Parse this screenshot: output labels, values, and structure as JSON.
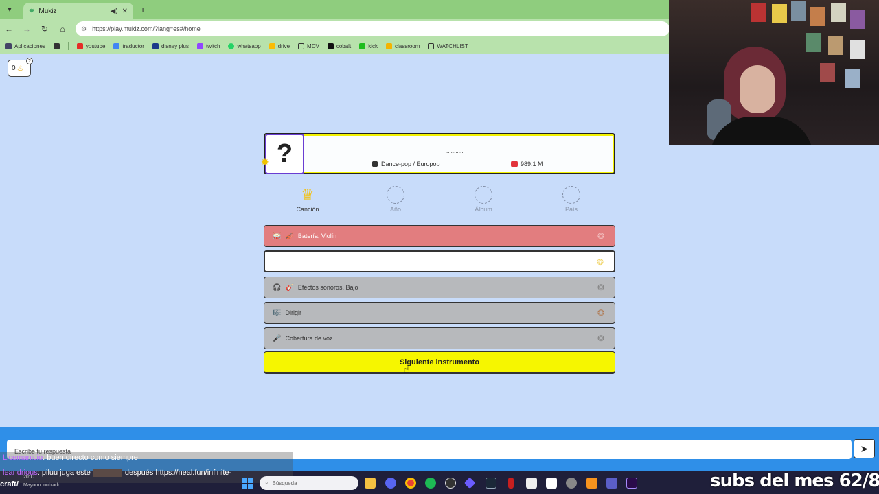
{
  "browser": {
    "tab_title": "Mukiz",
    "url": "https://play.mukiz.com/?lang=es#/home",
    "bookmarks": [
      "Aplicaciones",
      "youtube",
      "traductor",
      "disney plus",
      "twitch",
      "whatsapp",
      "drive",
      "MDV",
      "cobalt",
      "kick",
      "classroom",
      "WATCHLIST"
    ]
  },
  "game": {
    "streak": "0",
    "mystery": "?",
    "genre": "Dance-pop / Europop",
    "plays": "989.1 M",
    "steps": [
      {
        "label": "Canción",
        "active": true
      },
      {
        "label": "Año",
        "active": false
      },
      {
        "label": "Álbum",
        "active": false
      },
      {
        "label": "País",
        "active": false
      }
    ],
    "rows": [
      {
        "text": "Batería, Violín",
        "state": "wrong"
      },
      {
        "text": "",
        "state": "current"
      },
      {
        "text": "Efectos sonoros, Bajo",
        "state": "locked"
      },
      {
        "text": "Dirigir",
        "state": "locked"
      },
      {
        "text": "Cobertura de voz",
        "state": "locked"
      }
    ],
    "next_button": "Siguiente instrumento",
    "answer_placeholder": "Escribe tu respuesta",
    "send_icon": "send-arrow-icon"
  },
  "chat": {
    "line1_user": "Licemanicio",
    "line1_text": ": buen directo como siempre",
    "line2_user": "leandrious",
    "line2_text": ": piluu juga este",
    "line2_text_after": "después https://neal.fun/infinite-",
    "line3_text": "craft/"
  },
  "taskbar": {
    "weather_temp": "20°C",
    "weather_desc": "Mayorm. nublado",
    "search_placeholder": "Búsqueda"
  },
  "overlay": {
    "subs_text": "subs del mes 62/80"
  },
  "colors": {
    "page_bg": "#c8dcfa",
    "accent_yellow": "#f6f600",
    "wrong_red": "#e27d7f",
    "locked_gray": "#b7b9bc",
    "chrome_green": "#8fcd7e",
    "answer_bar_blue": "#2f8fe8"
  }
}
